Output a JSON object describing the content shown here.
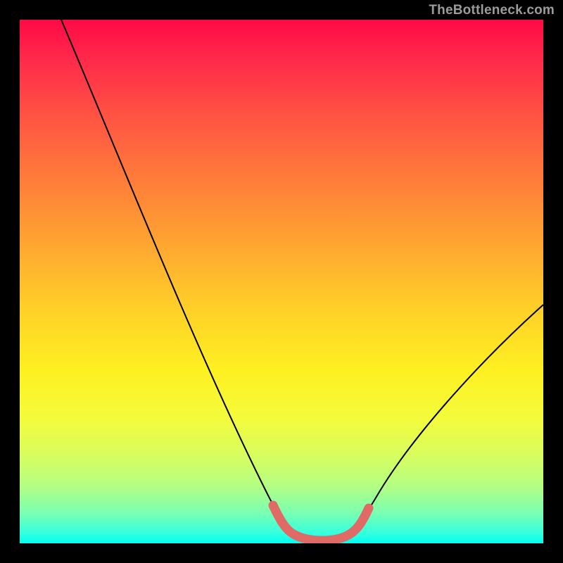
{
  "watermark": {
    "text": "TheBottleneck.com"
  },
  "colors": {
    "curve": "#000000",
    "highlight": "#e06a65",
    "gradient_top": "#ff0a46",
    "gradient_bottom": "#00fff2"
  },
  "chart_data": {
    "type": "line",
    "title": "",
    "xlabel": "",
    "ylabel": "",
    "xlim": [
      0,
      100
    ],
    "ylim": [
      0,
      100
    ],
    "grid": false,
    "series": [
      {
        "name": "bottleneck-curve",
        "x": [
          8,
          12,
          16,
          20,
          24,
          28,
          32,
          36,
          40,
          44,
          48,
          50,
          52,
          54,
          56,
          58,
          60,
          62,
          65,
          70,
          75,
          80,
          85,
          90,
          95,
          100
        ],
        "values": [
          100,
          91,
          82,
          74,
          65,
          56,
          47,
          38,
          29,
          20,
          11,
          7,
          4,
          2,
          1,
          1,
          1,
          2,
          4,
          11,
          19,
          27,
          35,
          43,
          51,
          59
        ]
      },
      {
        "name": "optimal-range-highlight",
        "x": [
          50,
          52,
          54,
          56,
          58,
          60,
          62
        ],
        "values": [
          7,
          4,
          2,
          1,
          1,
          1,
          2
        ]
      }
    ]
  }
}
